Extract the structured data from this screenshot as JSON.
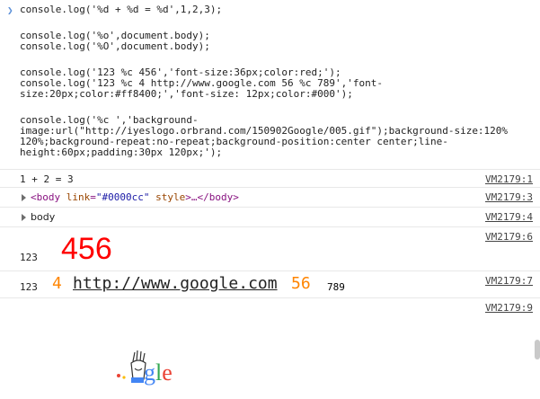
{
  "code_lines": [
    "console.log('%d + %d = %d',1,2,3);",
    "",
    "console.log('%o',document.body);",
    "console.log('%O',document.body);",
    "",
    "console.log('123 %c 456','font-size:36px;color:red;');",
    "console.log('123 %c 4 http://www.google.com 56 %c 789','font-",
    "size:20px;color:#ff8400;','font-size: 12px;color:#000');",
    "",
    "console.log('%c ','background-",
    "image:url(\"http://iyeslogo.orbrand.com/150902Google/005.gif\");background-size:120%",
    "120%;background-repeat:no-repeat;background-position:center center;line-",
    "height:60px;padding:30px 120px;');"
  ],
  "outputs": {
    "sum": {
      "text": "1 + 2 = 3",
      "source": "VM2179:1"
    },
    "body_o": {
      "tag_open": "<body",
      "attr1_name": " link",
      "attr1_eq": "=",
      "attr1_val": "\"#0000cc\"",
      "attr2_name": " style",
      "close": ">…</body>",
      "source": "VM2179:3"
    },
    "body_O": {
      "text": "body",
      "source": "VM2179:4"
    },
    "big": {
      "prefix": "123",
      "styled": "456",
      "source": "VM2179:6"
    },
    "mixed": {
      "prefix": "123",
      "part1": "4",
      "link": "http://www.google.com",
      "part2": "56",
      "part3": "789",
      "source": "VM2179:7"
    },
    "image": {
      "source": "VM2179:9",
      "logo_text": "gle"
    }
  },
  "colors": {
    "prompt": "#5a8fd8",
    "red_text": "#ff0000",
    "orange_text": "#ff8400",
    "string": "#c41a16"
  }
}
